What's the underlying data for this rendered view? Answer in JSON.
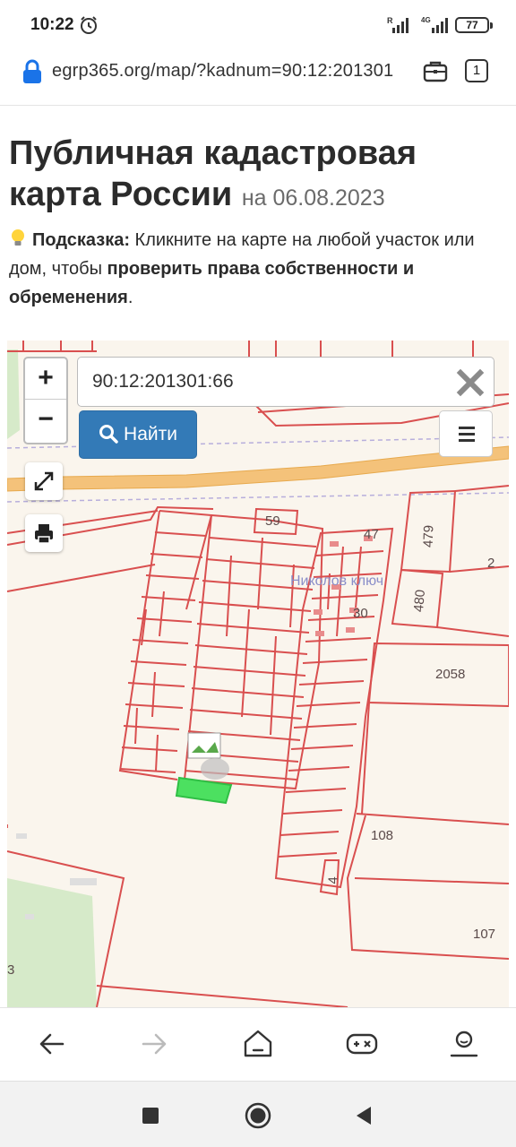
{
  "status_bar": {
    "time": "10:22",
    "battery": "77",
    "net_r": "R",
    "net_4g": "4G"
  },
  "browser": {
    "url": "egrp365.org/map/?kadnum=90:12:201301",
    "tabs_count": "1"
  },
  "page": {
    "title": "Публичная кадастровая карта России",
    "date": "на 06.08.2023",
    "hint": {
      "label": "Подсказка:",
      "text1": " Кликните на карте на любой участок или дом, чтобы ",
      "bold": "проверить права собственности и обременения",
      "text2": "."
    }
  },
  "map": {
    "search_value": "90:12:201301:66",
    "zoom_in": "+",
    "zoom_out": "−",
    "find_label": "Найти",
    "labels": {
      "p59": "59",
      "p47": "47",
      "p479": "479",
      "p2": "2",
      "locality": "Николов ключ",
      "p480": "480",
      "p30": "30",
      "p2058": "2058",
      "p108": "108",
      "p4": "4",
      "p107": "107",
      "p3": "3"
    },
    "colors": {
      "parcel": "#d94f4f",
      "road": "#f0b866",
      "highlight": "#4ce060",
      "forest": "#cfe6c2"
    }
  },
  "toolbar": {
    "icons": [
      "back-icon",
      "forward-icon",
      "home-icon",
      "game-icon",
      "profile-icon"
    ]
  },
  "android_nav": {
    "icons": [
      "recents-icon",
      "home-circle-icon",
      "back-triangle-icon"
    ]
  }
}
